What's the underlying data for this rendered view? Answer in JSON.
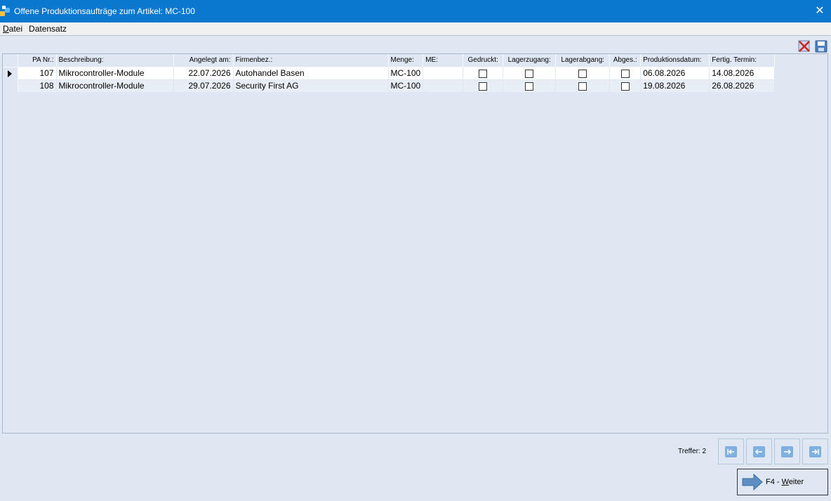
{
  "window": {
    "title": "Offene Produktionsaufträge zum Artikel: MC-100",
    "close_glyph": "✕"
  },
  "menu": {
    "items": [
      {
        "label": "Datei",
        "underline": "D",
        "rest": "atei"
      },
      {
        "label": "Datensatz",
        "underline": "",
        "rest": "Datensatz"
      }
    ]
  },
  "toolbar": {
    "icons": [
      "delete-record-icon",
      "save-disk-icon"
    ]
  },
  "grid": {
    "columns": [
      {
        "label": "PA Nr.:",
        "align": "right",
        "width": 76
      },
      {
        "label": "Beschreibung:",
        "align": "left",
        "width": 167
      },
      {
        "label": "Angelegt am:",
        "align": "right",
        "width": 85
      },
      {
        "label": "Firmenbez.:",
        "align": "left",
        "width": 221
      },
      {
        "label": "Menge:",
        "align": "left",
        "width": 47
      },
      {
        "label": "ME:",
        "align": "left",
        "width": 57
      },
      {
        "label": "Gedruckt:",
        "align": "center",
        "width": 57
      },
      {
        "label": "Lagerzugang:",
        "align": "center",
        "width": 75
      },
      {
        "label": "Lagerabgang:",
        "align": "center",
        "width": 77
      },
      {
        "label": "Abges.:",
        "align": "center",
        "width": 44
      },
      {
        "label": "Produktionsdatum:",
        "align": "left",
        "width": 98
      },
      {
        "label": "Fertig. Termin:",
        "align": "left",
        "width": 93
      }
    ],
    "rows": [
      {
        "pa_nr": "107",
        "beschreibung": "Mikrocontroller-Module",
        "angelegt": "22.07.2026",
        "firma": "Autohandel Basen",
        "menge": "MC-100",
        "me": "",
        "gedruckt": false,
        "lagerzugang": false,
        "lagerabgang": false,
        "abges": false,
        "produktionsdatum": "06.08.2026",
        "fertig_termin": "14.08.2026",
        "current": true
      },
      {
        "pa_nr": "108",
        "beschreibung": "Mikrocontroller-Module",
        "angelegt": "29.07.2026",
        "firma": "Security First AG",
        "menge": "MC-100",
        "me": "",
        "gedruckt": false,
        "lagerzugang": false,
        "lagerabgang": false,
        "abges": false,
        "produktionsdatum": "19.08.2026",
        "fertig_termin": "26.08.2026",
        "current": false
      }
    ]
  },
  "footer": {
    "treffer": "Treffer: 2",
    "nav_buttons": [
      "first-record-icon",
      "prev-record-icon",
      "next-record-icon",
      "last-record-icon"
    ],
    "weiter_prefix": "F4 - ",
    "weiter_underline": "W",
    "weiter_rest": "eiter"
  },
  "colors": {
    "titlebar": "#0b78d0",
    "background": "#dfe8f2",
    "nav_icon": "#7fb0e0"
  }
}
